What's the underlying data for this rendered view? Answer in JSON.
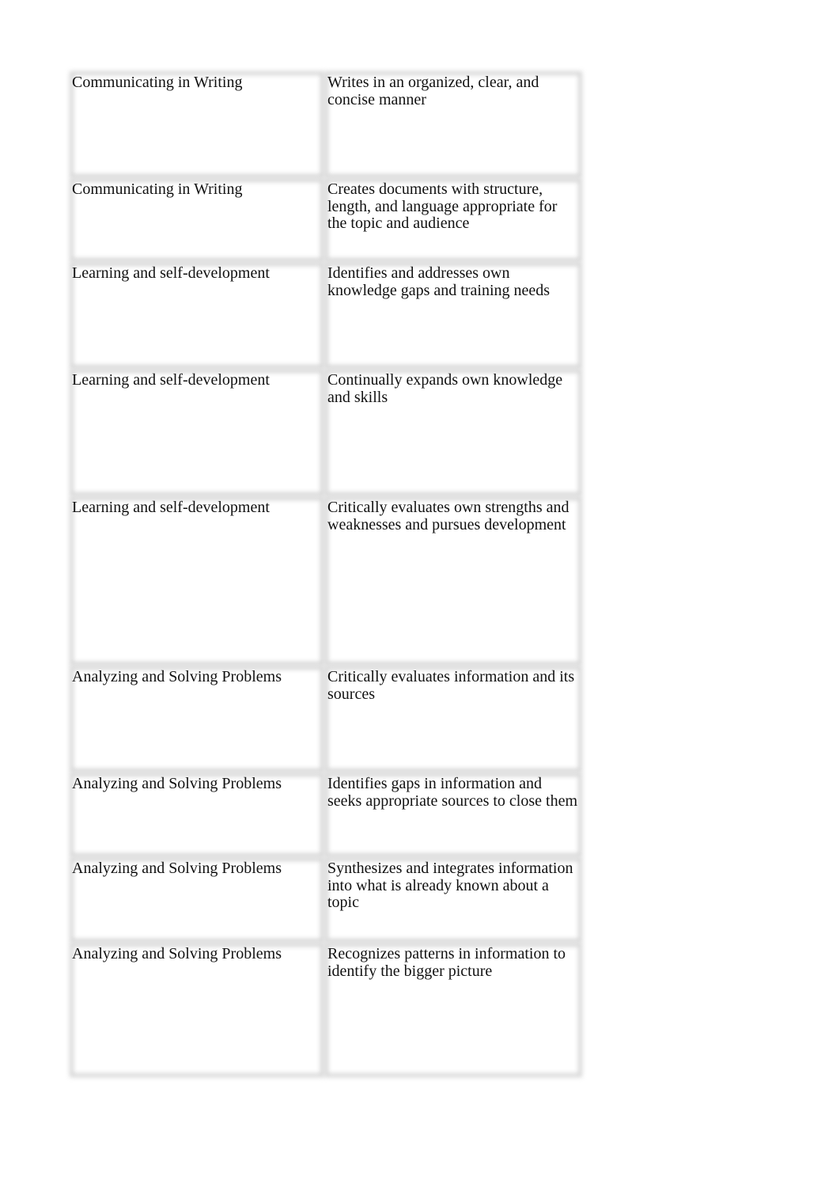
{
  "table": {
    "rows": [
      {
        "competency": "Communicating in Writing",
        "behavior": "Writes in an organized, clear, and concise manner"
      },
      {
        "competency": "Communicating in Writing",
        "behavior": "Creates documents with structure, length, and language appropriate for the topic and audience"
      },
      {
        "competency": "Learning and self-development",
        "behavior": "Identifies and addresses own knowledge gaps and training needs"
      },
      {
        "competency": "Learning and self-development",
        "behavior": "Continually expands own knowledge and skills"
      },
      {
        "competency": "Learning and self-development",
        "behavior": "Critically evaluates own strengths and weaknesses and pursues development"
      },
      {
        "competency": "Analyzing and Solving Problems",
        "behavior": "Critically evaluates information and its sources"
      },
      {
        "competency": "Analyzing and Solving Problems",
        "behavior": "Identifies gaps in information and seeks appropriate sources to close them"
      },
      {
        "competency": "Analyzing and Solving Problems",
        "behavior": "Synthesizes and integrates information into what is already known about a topic"
      },
      {
        "competency": "Analyzing and Solving Problems",
        "behavior": "Recognizes patterns in information to identify the bigger picture"
      }
    ]
  }
}
